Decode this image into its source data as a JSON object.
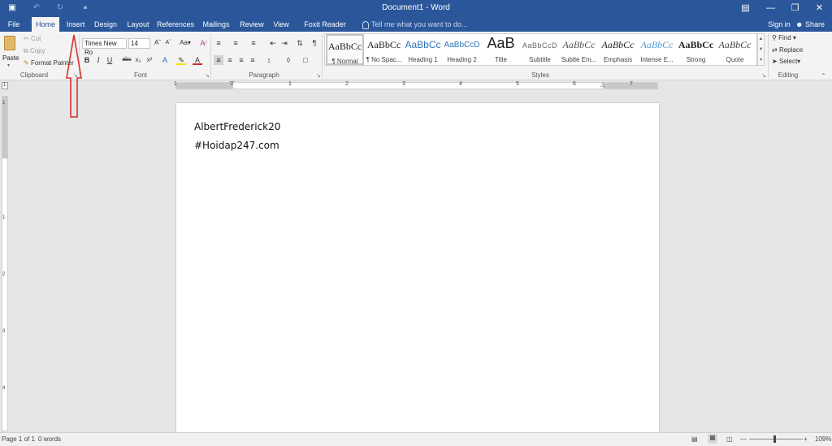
{
  "window": {
    "title": "Document1 - Word",
    "sign_in": "Sign in",
    "share": "Share"
  },
  "tabs": [
    {
      "label": "File"
    },
    {
      "label": "Home"
    },
    {
      "label": "Insert"
    },
    {
      "label": "Design"
    },
    {
      "label": "Layout"
    },
    {
      "label": "References"
    },
    {
      "label": "Mailings"
    },
    {
      "label": "Review"
    },
    {
      "label": "View"
    },
    {
      "label": "Foxit Reader PDF"
    }
  ],
  "tell_me_placeholder": "Tell me what you want to do...",
  "clipboard": {
    "paste": "Paste",
    "cut": "Cut",
    "copy": "Copy",
    "format_painter": "Format Painter",
    "label": "Clipboard"
  },
  "font": {
    "name": "Times New Ro",
    "size": "14",
    "label": "Font"
  },
  "paragraph": {
    "label": "Paragraph"
  },
  "styles": {
    "label": "Styles",
    "items": [
      {
        "sample": "AaBbCc",
        "name": "¶ Normal"
      },
      {
        "sample": "AaBbCc",
        "name": "¶ No Spac..."
      },
      {
        "sample": "AaBbCc",
        "name": "Heading 1"
      },
      {
        "sample": "AaBbCcD",
        "name": "Heading 2"
      },
      {
        "sample": "AaB",
        "name": "Title"
      },
      {
        "sample": "AaBbCcD",
        "name": "Subtitle"
      },
      {
        "sample": "AaBbCc",
        "name": "Subtle Em..."
      },
      {
        "sample": "AaBbCc",
        "name": "Emphasis"
      },
      {
        "sample": "AaBbCc",
        "name": "Intense E..."
      },
      {
        "sample": "AaBbCc",
        "name": "Strong"
      },
      {
        "sample": "AaBbCc",
        "name": "Quote"
      }
    ]
  },
  "editing": {
    "find": "Find",
    "replace": "Replace",
    "select": "Select",
    "label": "Editing"
  },
  "document": {
    "lines": [
      "AlbertFrederick20",
      "#Hoidap247.com"
    ]
  },
  "ruler": {
    "labels": [
      "1",
      "1",
      "2",
      "3",
      "4",
      "5",
      "6",
      "7"
    ]
  },
  "vruler": {
    "labels": [
      "1",
      "1",
      "2",
      "3",
      "4"
    ]
  },
  "status": {
    "page": "Page 1 of 1",
    "words": "0 words",
    "zoom": "109%"
  },
  "colors": {
    "accent": "#2b579a",
    "annotation": "#d9302b"
  }
}
